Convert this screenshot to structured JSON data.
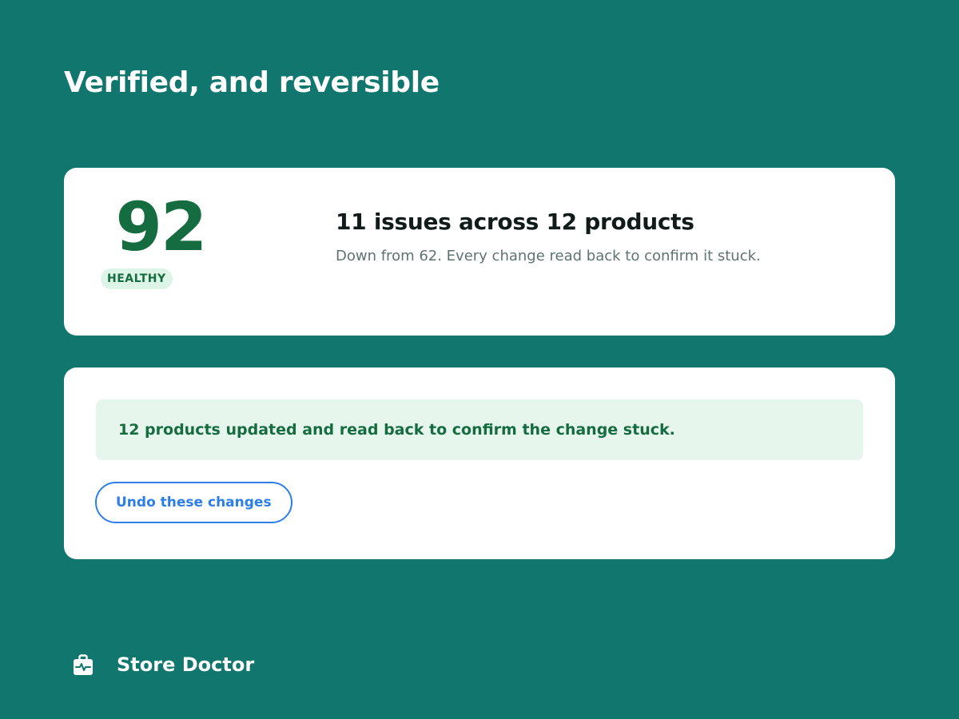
{
  "page": {
    "title": "Verified, and reversible"
  },
  "score_card": {
    "score": "92",
    "status_badge": "HEALTHY",
    "issues_heading": "11 issues across 12 products",
    "issues_subtext": "Down from 62. Every change read back to confirm it stuck."
  },
  "result_card": {
    "success_message": "12 products updated and read back to confirm the change stuck.",
    "undo_button_label": "Undo these changes"
  },
  "footer": {
    "brand_name": "Store Doctor",
    "brand_icon": "medical-bag-icon"
  },
  "colors": {
    "background": "#10766e",
    "card": "#ffffff",
    "score_green": "#166c41",
    "badge_bg": "#dcf5e6",
    "banner_bg": "#e6f6ec",
    "heading_text": "#111c1a",
    "muted_text": "#5e7371",
    "button_blue": "#2d7ee6"
  }
}
